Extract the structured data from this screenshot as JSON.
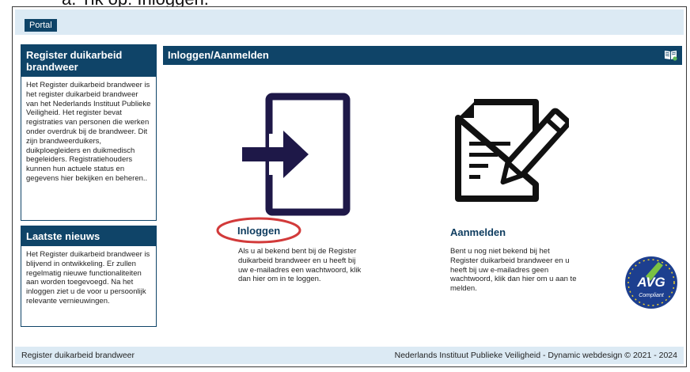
{
  "top_partial_text": "a.   Tik op: Inloggen.",
  "topbar": {
    "portal_label": "Portal"
  },
  "sidebar": {
    "register": {
      "title": "Register duikarbeid brandweer",
      "text": "Het Register duikarbeid brandweer is het register duikarbeid brandweer van het Nederlands Instituut Publieke Veiligheid. Het register bevat registraties van personen die werken onder overdruk bij de brandweer. Dit zijn brandweerduikers, duikploegleiders en duikmedisch begeleiders. Registratiehouders kunnen hun actuele status en gegevens hier bekijken en beheren.."
    },
    "news": {
      "title": "Laatste nieuws",
      "text": "Het Register duikarbeid brandweer is blijvend in ontwikkeling. Er zullen regelmatig nieuwe functionaliteiten aan worden toegevoegd. Na het inloggen ziet u de voor u persoonlijk relevante vernieuwingen."
    }
  },
  "main": {
    "title": "Inloggen/Aanmelden",
    "help_icon": "book-icon",
    "login": {
      "title": "Inloggen",
      "text": "Als u al bekend bent bij de Register duikarbeid brandweer en u heeft bij uw e-mailadres een wachtwoord, klik dan hier om in te loggen.",
      "icon": "login-icon"
    },
    "register": {
      "title": "Aanmelden",
      "text": "Bent u nog niet bekend bij het Register duikarbeid brandweer en u heeft bij uw e-mailadres geen wachtwoord, klik dan hier om u aan te melden.",
      "icon": "document-pen-icon"
    },
    "badge": {
      "main": "AVG",
      "sub": "Compliant"
    }
  },
  "footer": {
    "left": "Register duikarbeid brandweer",
    "right": "Nederlands Instituut Publieke Veiligheid - Dynamic webdesign © 2021 - 2024"
  },
  "colors": {
    "primary": "#0f4468",
    "light_bar": "#dceaf4",
    "highlight_circle": "#d23a3a",
    "icon_navy": "#1e1848"
  }
}
